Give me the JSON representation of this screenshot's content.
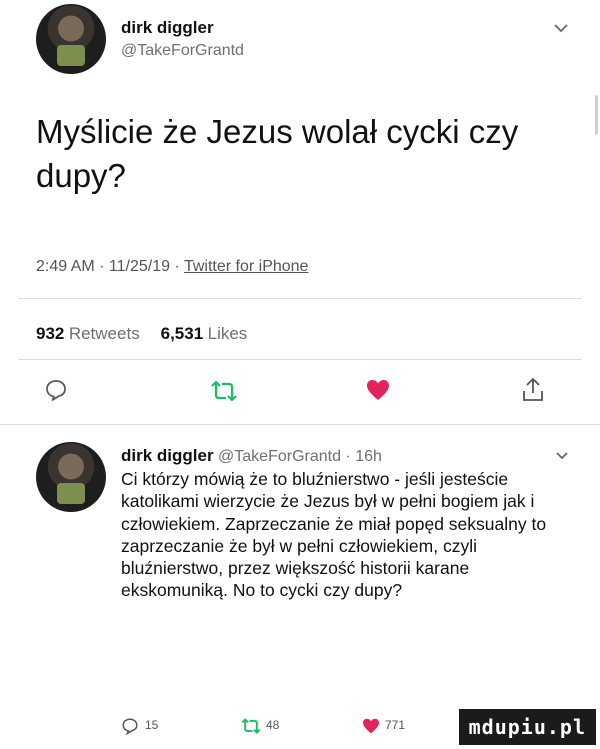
{
  "tweet": {
    "author_name": "dirk diggler",
    "author_handle": "@TakeForGrantd",
    "text": "Myślicie że Jezus wolał cycki czy dupy?",
    "time": "2:49 AM · 11/25/19 · ",
    "source": "Twitter for iPhone",
    "retweets_count": "932",
    "retweets_label": "Retweets",
    "likes_count": "6,531",
    "likes_label": "Likes"
  },
  "reply": {
    "author_name": "dirk diggler",
    "author_handle_time": "@TakeForGrantd · 16h",
    "text": "Ci którzy mówią że to bluźnierstwo - jeśli jesteście katolikami wierzycie że Jezus był w pełni bogiem jak i człowiekiem. Zaprzeczanie że miał popęd seksualny to zaprzeczanie że był w pełni człowiekiem, czyli bluźnierstwo, przez większość historii karane ekskomuniką. No to cycki czy dupy?",
    "reply_count": "15",
    "retweet_count": "48",
    "like_count": "771"
  },
  "watermark": "mdupiu.pl",
  "colors": {
    "like": "#e0245e",
    "retweet": "#17bf63",
    "icon": "#555555"
  }
}
